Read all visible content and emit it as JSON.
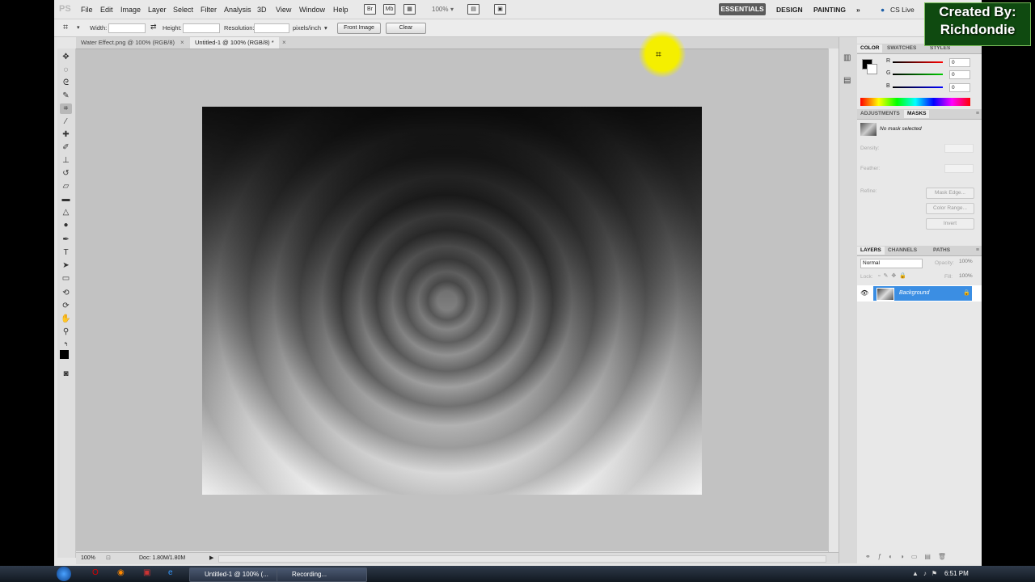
{
  "menubar": {
    "logo": "PS",
    "items": [
      "File",
      "Edit",
      "Image",
      "Layer",
      "Select",
      "Filter",
      "Analysis",
      "3D",
      "View",
      "Window",
      "Help"
    ],
    "zoom": "100%",
    "workspaces": {
      "active": "ESSENTIALS",
      "others": [
        "DESIGN",
        "PAINTING"
      ]
    },
    "more": "»",
    "cs_live": "CS Live"
  },
  "options": {
    "width_label": "Width:",
    "height_label": "Height:",
    "resolution_label": "Resolution:",
    "resolution_unit": "pixels/inch",
    "front_image": "Front Image",
    "clear": "Clear"
  },
  "tabs": [
    "Water Effect.png @ 100% (RGB/8)",
    "Untitled-1 @ 100% (RGB/8) *"
  ],
  "status": {
    "zoom": "100%",
    "doc": "Doc: 1.80M/1.80M"
  },
  "color_panel": {
    "tabs": [
      "COLOR",
      "SWATCHES",
      "STYLES"
    ],
    "channels": [
      {
        "label": "R",
        "value": "0",
        "color": "#d22"
      },
      {
        "label": "G",
        "value": "0",
        "color": "#2a2"
      },
      {
        "label": "B",
        "value": "0",
        "color": "#22c"
      }
    ]
  },
  "masks_panel": {
    "tabs": [
      "ADJUSTMENTS",
      "MASKS"
    ],
    "info": "No mask selected",
    "density": "Density:",
    "feather": "Feather:",
    "refine": "Refine:",
    "mask_edge": "Mask Edge...",
    "color_range": "Color Range...",
    "invert": "Invert"
  },
  "layers_panel": {
    "tabs": [
      "LAYERS",
      "CHANNELS",
      "PATHS"
    ],
    "blend_mode": "Normal",
    "opacity_label": "Opacity:",
    "opacity": "100%",
    "lock_label": "Lock:",
    "fill_label": "Fill:",
    "fill": "100%",
    "layer_name": "Background"
  },
  "taskbar": {
    "items": [
      "Untitled-1 @ 100% (...",
      "Recording..."
    ],
    "clock": "6:51 PM"
  },
  "watermark": {
    "line1": "Created By:",
    "line2": "Richdondie"
  }
}
